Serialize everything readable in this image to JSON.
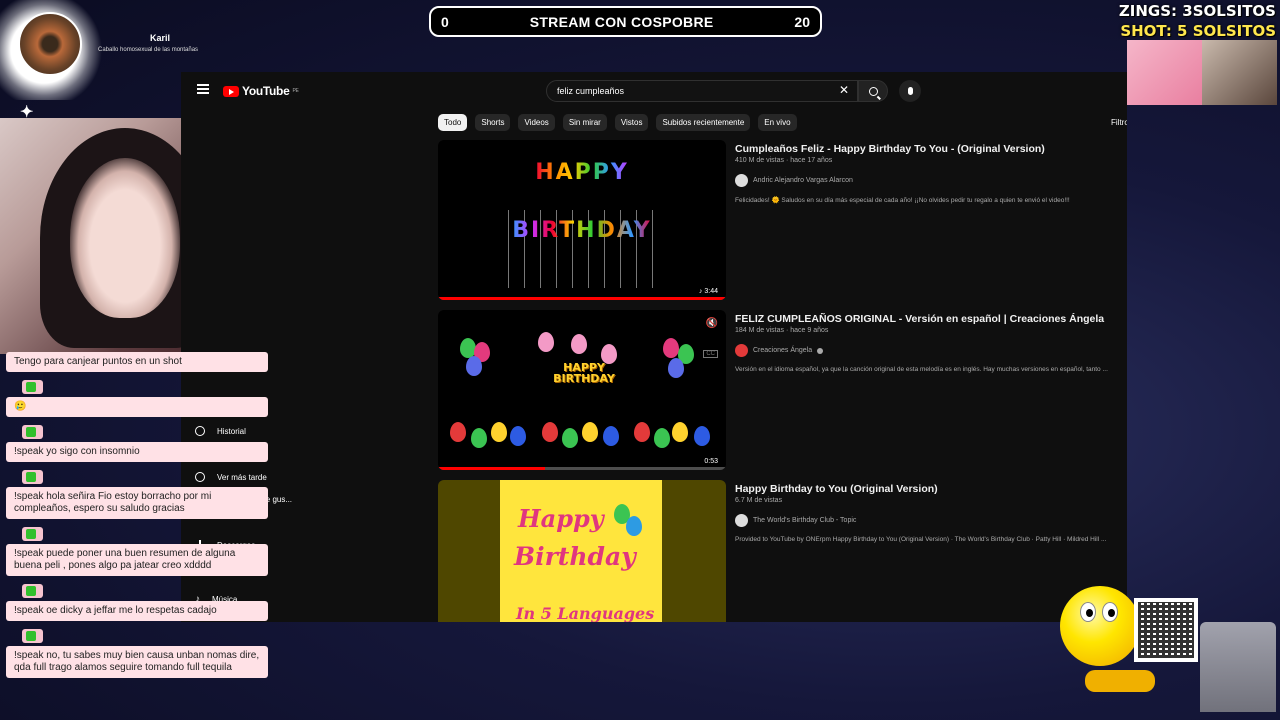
{
  "overlay": {
    "banner_left": "0",
    "banner_title": "STREAM CON COSPOBRE",
    "banner_right": "20",
    "zings": "ZINGS: 3SOLSITOS",
    "shot": "SHOT: 5 SOLSITOS",
    "profile_name": "Karil",
    "profile_subtitle": "Caballo homosexual de las montañas",
    "chat": [
      {
        "user": "",
        "text": "Tengo para canjear puntos en un shot"
      },
      {
        "user": "",
        "text": "🥲"
      },
      {
        "user": "",
        "text": "!speak yo sigo con insomnio"
      },
      {
        "user": "",
        "text": "!speak hola señira Fio estoy borracho por mi compleaños, espero su saludo gracias"
      },
      {
        "user": "",
        "text": "!speak puede poner una buen resumen de alguna buena peli , pones algo pa jatear creo xdddd"
      },
      {
        "user": "",
        "text": "!speak oe dicky a jeffar me lo respetas cadajo"
      },
      {
        "user": "",
        "text": "!speak no, tu sabes muy bien causa unban nomas dire, qda full trago alamos seguire tomando full tequila"
      }
    ]
  },
  "youtube": {
    "logo_text": "YouTube",
    "region": "PE",
    "search_value": "feliz cumpleaños",
    "chips": [
      "Todo",
      "Shorts",
      "Videos",
      "Sin mirar",
      "Vistos",
      "Subidos recientemente",
      "En vivo"
    ],
    "filters_label": "Filtros",
    "sidebar": {
      "historial": "Historial",
      "ver_mas_tarde": "Ver más tarde",
      "tus_gustos": "Videos que me gus...",
      "descargas": "Descargas",
      "musica": "Música"
    },
    "results": [
      {
        "title": "Cumpleaños Feliz - Happy Birthday To You - (Original Version)",
        "meta": "410 M de vistas · hace 17 años",
        "channel": "Andric Alejandro Vargas Alarcon",
        "description": "Felicidades! 🌞 Saludos en su día más especial de cada año! ¡¡No olvides pedir tu regalo a quien te envió el video!!!",
        "duration": "3:44",
        "thumb_happy": "HAPPY",
        "thumb_birthday": "BIRTHDAY",
        "watched_fraction": 1.0
      },
      {
        "title": "FELIZ CUMPLEAÑOS ORIGINAL - Versión en español | Creaciones Ángela",
        "meta": "184 M de vistas · hace 9 años",
        "channel": "Creaciones Ángela",
        "description": "Versión en el idioma español, ya que la canción original de esta melodía es en inglés. Hay muchas versiones en español, tanto ...",
        "duration": "0:53",
        "thumb_label_1": "HAPPY",
        "thumb_label_2": "BIRTHDAY",
        "watched_fraction": 0.37
      },
      {
        "title": "Happy Birthday to You (Original Version)",
        "meta": "6.7 M de vistas",
        "channel": "The World's Birthday Club - Topic",
        "description": "Provided to YouTube by ONErpm Happy Birthday to You (Original Version) · The World's Birthday Club · Patty Hill · Mildred Hill ...",
        "thumb_line1": "Happy",
        "thumb_line2": "Birthday",
        "thumb_line3": "In 5 Languages"
      }
    ]
  },
  "colors": {
    "yt_bg": "#0f0f0f",
    "accent_red": "#ff0000",
    "shot_yellow": "#ffe74d",
    "chat_pink": "#ffe1e6"
  }
}
